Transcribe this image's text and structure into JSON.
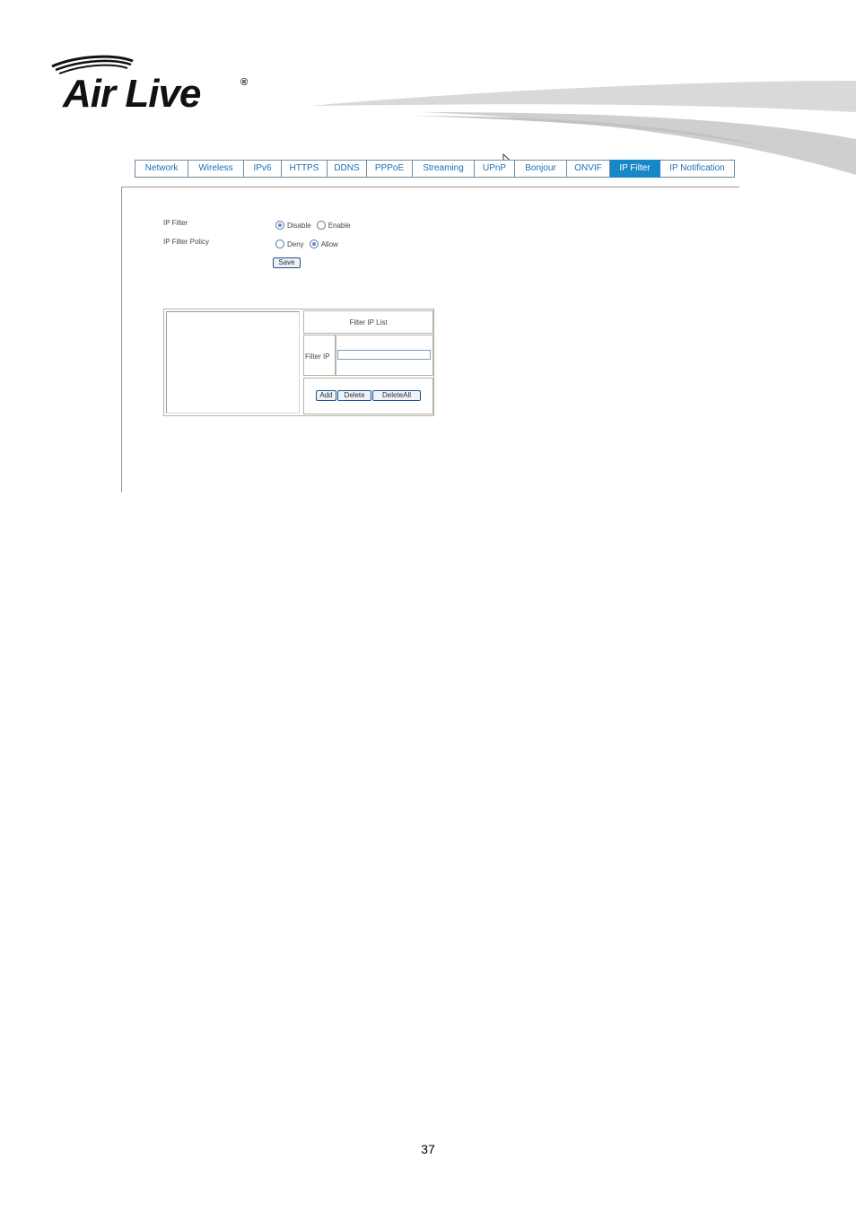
{
  "brand": {
    "logo_text": "Air Live",
    "registered_mark": "®"
  },
  "tabs": [
    {
      "label": "Network"
    },
    {
      "label": "Wireless"
    },
    {
      "label": "IPv6"
    },
    {
      "label": "HTTPS"
    },
    {
      "label": "DDNS"
    },
    {
      "label": "PPPoE"
    },
    {
      "label": "Streaming"
    },
    {
      "label": "UPnP"
    },
    {
      "label": "Bonjour"
    },
    {
      "label": "ONVIF"
    },
    {
      "label": "IP Filter",
      "active": true
    },
    {
      "label": "IP Notification"
    }
  ],
  "form": {
    "ip_filter_label": "IP Filter",
    "ip_filter_options": [
      "Disable",
      "Enable"
    ],
    "ip_filter_selected": "Disable",
    "policy_label": "IP Filter Policy",
    "policy_options": [
      "Deny",
      "Allow"
    ],
    "policy_selected": "Allow",
    "save_label": "Save"
  },
  "filter_list": {
    "header": "Filter IP List",
    "field_label": "Filter IP",
    "field_value": "",
    "add_label": "Add",
    "delete_label": "Delete",
    "delete_all_label": "DeleteAll",
    "entries": []
  },
  "colors": {
    "accent": "#1787c8",
    "tab_text": "#1f6fb0"
  },
  "footer": {
    "page_number": "37"
  }
}
